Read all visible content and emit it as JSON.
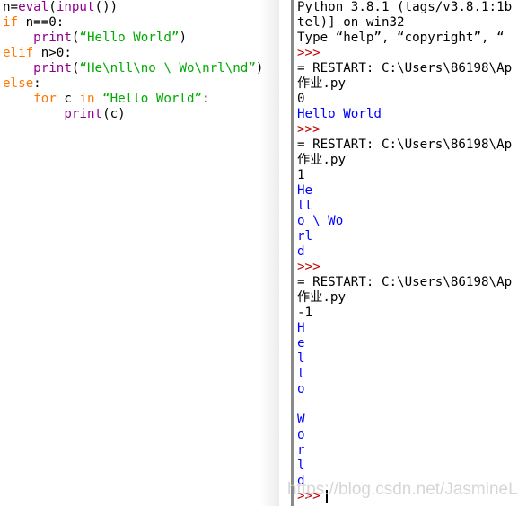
{
  "editor": {
    "lines": [
      [
        {
          "t": "n=",
          "c": "plain"
        },
        {
          "t": "eval",
          "c": "bi"
        },
        {
          "t": "(",
          "c": "plain"
        },
        {
          "t": "input",
          "c": "bi"
        },
        {
          "t": "())",
          "c": "plain"
        }
      ],
      [
        {
          "t": "if",
          "c": "kw"
        },
        {
          "t": " n==0:",
          "c": "plain"
        }
      ],
      [
        {
          "t": "    ",
          "c": "plain"
        },
        {
          "t": "print",
          "c": "bi"
        },
        {
          "t": "(",
          "c": "plain"
        },
        {
          "t": "“Hello World”",
          "c": "str"
        },
        {
          "t": ")",
          "c": "plain"
        }
      ],
      [
        {
          "t": "elif",
          "c": "kw"
        },
        {
          "t": " n>0:",
          "c": "plain"
        }
      ],
      [
        {
          "t": "    ",
          "c": "plain"
        },
        {
          "t": "print",
          "c": "bi"
        },
        {
          "t": "(",
          "c": "plain"
        },
        {
          "t": "“He\\nll\\no \\ Wo\\nrl\\nd”",
          "c": "str"
        },
        {
          "t": ")",
          "c": "plain"
        }
      ],
      [
        {
          "t": "else",
          "c": "kw"
        },
        {
          "t": ":",
          "c": "plain"
        }
      ],
      [
        {
          "t": "    ",
          "c": "plain"
        },
        {
          "t": "for",
          "c": "kw"
        },
        {
          "t": " c ",
          "c": "plain"
        },
        {
          "t": "in",
          "c": "kw"
        },
        {
          "t": " ",
          "c": "plain"
        },
        {
          "t": "“Hello World”",
          "c": "str"
        },
        {
          "t": ":",
          "c": "plain"
        }
      ],
      [
        {
          "t": "        ",
          "c": "plain"
        },
        {
          "t": "print",
          "c": "bi"
        },
        {
          "t": "(c)",
          "c": "plain"
        }
      ]
    ]
  },
  "shell": {
    "lines": [
      {
        "t": "Python 3.8.1 (tags/v3.8.1:1b",
        "c": "plain"
      },
      {
        "t": "tel)] on win32",
        "c": "plain"
      },
      {
        "t": "Type “help”, “copyright”, “",
        "c": "plain"
      },
      {
        "t": ">>>",
        "c": "prompt"
      },
      {
        "t": "= RESTART: C:\\Users\\86198\\Ap",
        "c": "plain"
      },
      {
        "t": "作业.py",
        "c": "plain"
      },
      {
        "t": "0",
        "c": "plain"
      },
      {
        "t": "Hello World",
        "c": "out"
      },
      {
        "t": ">>>",
        "c": "prompt"
      },
      {
        "t": "= RESTART: C:\\Users\\86198\\Ap",
        "c": "plain"
      },
      {
        "t": "作业.py",
        "c": "plain"
      },
      {
        "t": "1",
        "c": "plain"
      },
      {
        "t": "He",
        "c": "out"
      },
      {
        "t": "ll",
        "c": "out"
      },
      {
        "t": "o \\ Wo",
        "c": "out"
      },
      {
        "t": "rl",
        "c": "out"
      },
      {
        "t": "d",
        "c": "out"
      },
      {
        "t": ">>>",
        "c": "prompt"
      },
      {
        "t": "= RESTART: C:\\Users\\86198\\Ap",
        "c": "plain"
      },
      {
        "t": "作业.py",
        "c": "plain"
      },
      {
        "t": "-1",
        "c": "plain"
      },
      {
        "t": "H",
        "c": "out"
      },
      {
        "t": "e",
        "c": "out"
      },
      {
        "t": "l",
        "c": "out"
      },
      {
        "t": "l",
        "c": "out"
      },
      {
        "t": "o",
        "c": "out"
      },
      {
        "t": " ",
        "c": "out"
      },
      {
        "t": "W",
        "c": "out"
      },
      {
        "t": "o",
        "c": "out"
      },
      {
        "t": "r",
        "c": "out"
      },
      {
        "t": "l",
        "c": "out"
      },
      {
        "t": "d",
        "c": "out"
      }
    ],
    "final_prompt": ">>>"
  },
  "watermark": "https://blog.csdn.net/JasmineLinaa"
}
